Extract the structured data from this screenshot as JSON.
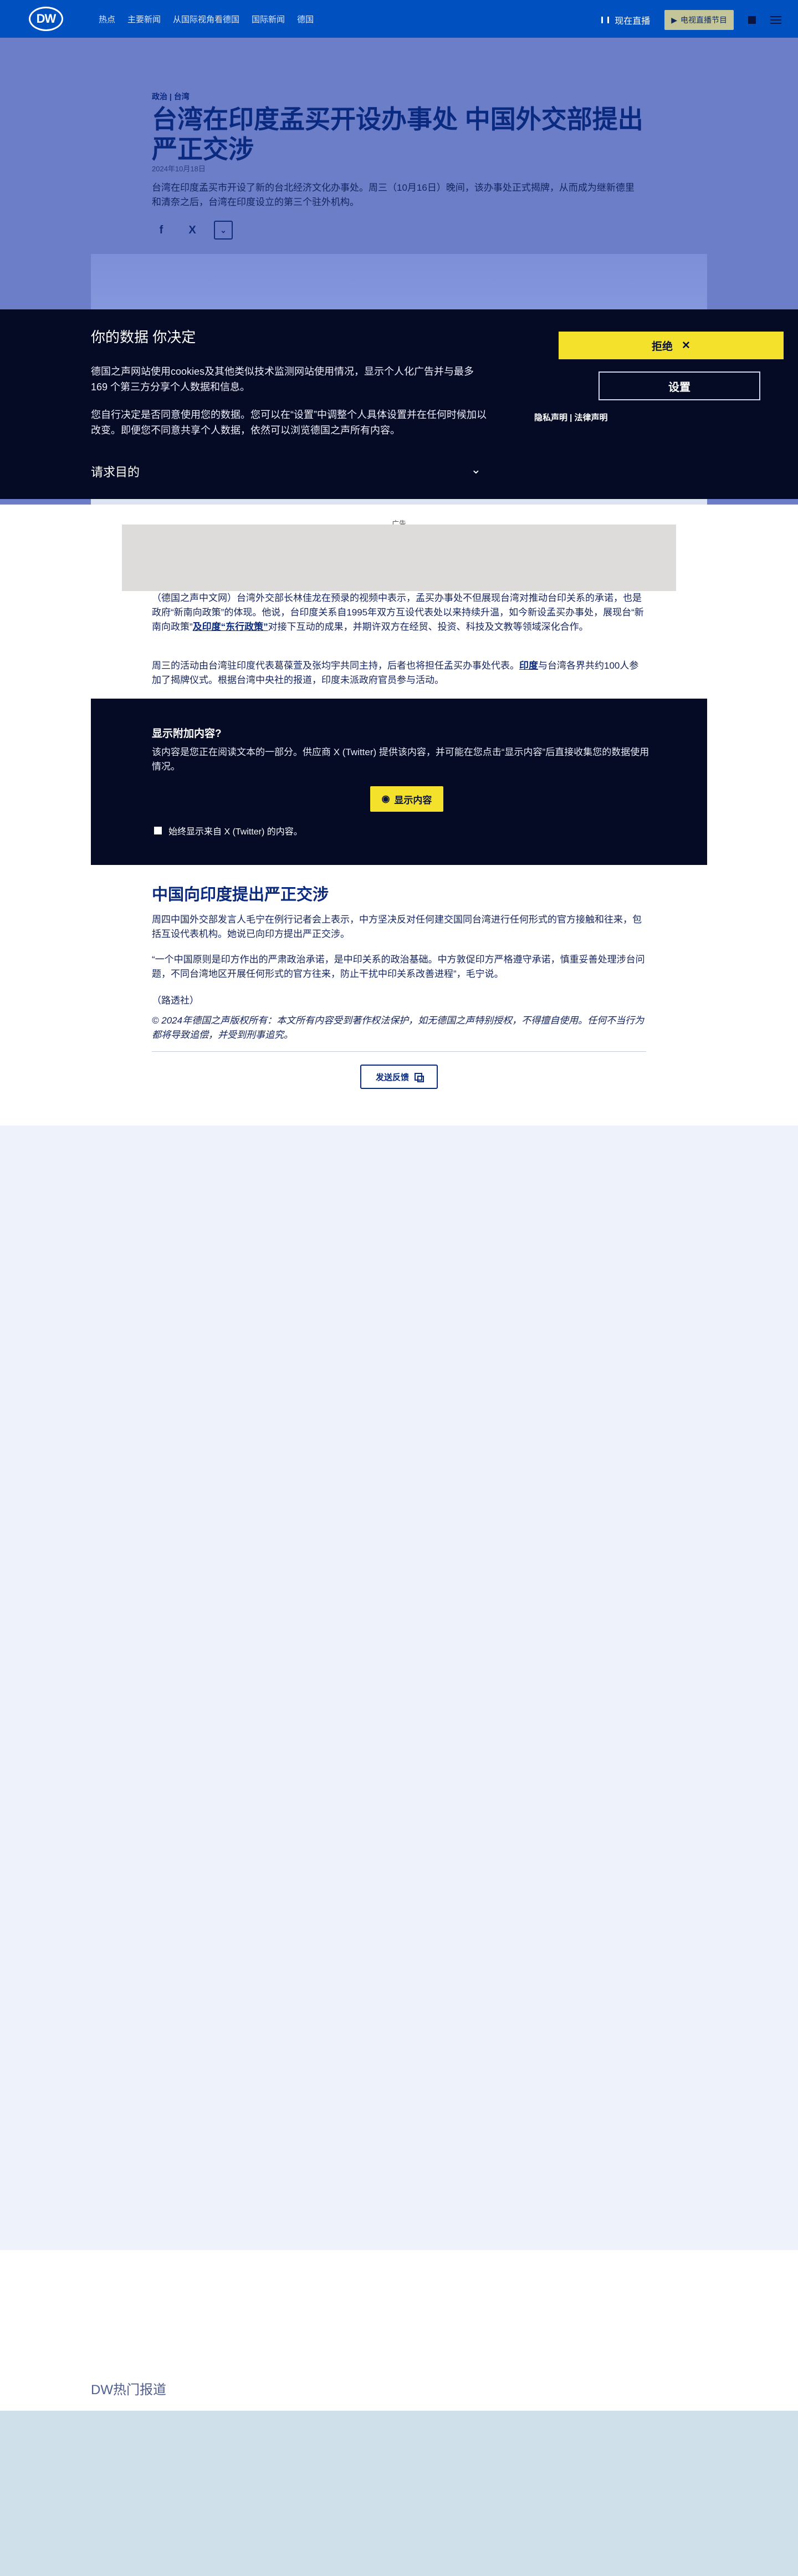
{
  "header": {
    "logo": "DW",
    "nav": [
      "热点",
      "主要新闻",
      "从国际视角看德国",
      "国际新闻",
      "德国"
    ],
    "live_label": "现在直播",
    "tv_label": "电视直播节目"
  },
  "article": {
    "kicker": "政治 | 台湾",
    "title": "台湾在印度孟买开设办事处 中国外交部提出严正交涉",
    "date": "2024年10月18日",
    "lede": "台湾在印度孟买市开设了新的台北经济文化办事处。周三（10月16日）晚间，该办事处正式揭牌，从而成为继新德里和清奈之后，台湾在印度设立的第三个驻外机构。",
    "share": {
      "facebook": "f",
      "x": "X",
      "more": "⌄"
    }
  },
  "consent": {
    "title": "你的数据 你决定",
    "p1": "德国之声网站使用cookies及其他类似技术监测网站使用情况，显示个人化广告并与最多169 个第三方分享个人数据和信息。",
    "p2": "您自行决定是否同意使用您的数据。您可以在“设置”中调整个人具体设置并在任何时候加以改变。即便您不同意共享个人数据，依然可以浏览德国之声所有内容。",
    "purpose": "请求目的",
    "reject": "拒绝",
    "settings": "设置",
    "links": "隐私声明 | 法律声明"
  },
  "body": {
    "ad_label": "广告",
    "p1_a": "（德国之声中文网）台湾外交部长林佳龙在预录的视频中表示，孟买办事处不但展现台湾对推动台印关系的承诺，也是政府“新南向政策”的体现。他说，台印度关系自1995年双方互设代表处以来持续升温，如今新设孟买办事处，展现台“新南向政策”",
    "p1_link": "及印度“东行政策”",
    "p1_b": "对接下互动的成果，并期许双方在经贸、投资、科技及文教等领域深化合作。",
    "p2_a": "周三的活动由台湾驻印度代表葛葆萱及张均宇共同主持，后者也将担任孟买办事处代表。",
    "p2_link": "印度",
    "p2_b": "与台湾各界共约100人参加了揭牌仪式。根据台湾中央社的报道，印度未派政府官员参与活动。",
    "embed_title": "显示附加内容?",
    "embed_text": "该内容是您正在阅读文本的一部分。供应商 X (Twitter) 提供该内容，并可能在您点击“显示内容”后直接收集您的数据使用情况。",
    "embed_button": "显示内容",
    "embed_check": "始终显示来自 X (Twitter) 的内容。",
    "h2": "中国向印度提出严正交涉",
    "p3": "周四中国外交部发言人毛宁在例行记者会上表示，中方坚决反对任何建交国同台湾进行任何形式的官方接触和往来，包括互设代表机构。她说已向印方提出严正交涉。",
    "p4": "“一个中国原则是印方作出的严肃政治承诺，是中印关系的政治基础。中方敦促印方严格遵守承诺，慎重妥善处理涉台问题，不同台湾地区开展任何形式的官方往来，防止干扰中印关系改善进程”，毛宁说。",
    "p5": "（路透社）",
    "copyright": "© 2024年德国之声版权所有：本文所有内容受到著作权法保护，如无德国之声特别授权，不得擅自使用。任何不当行为都将导致追偿，并受到刑事追究。",
    "feedback": "发送反馈"
  },
  "footer": {
    "hot": "DW热门报道"
  }
}
